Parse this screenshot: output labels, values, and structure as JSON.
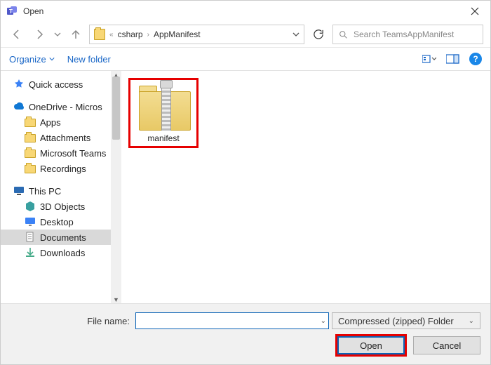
{
  "window": {
    "title": "Open"
  },
  "nav": {
    "breadcrumb_prefix": "«",
    "crumbs": [
      "csharp",
      "AppManifest"
    ]
  },
  "search": {
    "placeholder": "Search TeamsAppManifest"
  },
  "toolbar": {
    "organize": "Organize",
    "new_folder": "New folder"
  },
  "sidebar": {
    "quick_access": "Quick access",
    "onedrive": "OneDrive - Micros",
    "onedrive_children": [
      "Apps",
      "Attachments",
      "Microsoft Teams",
      "Recordings"
    ],
    "this_pc": "This PC",
    "this_pc_children": [
      "3D Objects",
      "Desktop",
      "Documents",
      "Downloads"
    ],
    "selected": "Documents"
  },
  "content": {
    "items": [
      {
        "name": "manifest",
        "kind": "zip"
      }
    ]
  },
  "bottom": {
    "filename_label": "File name:",
    "filename_value": "",
    "filter": "Compressed (zipped) Folder",
    "open": "Open",
    "cancel": "Cancel"
  }
}
